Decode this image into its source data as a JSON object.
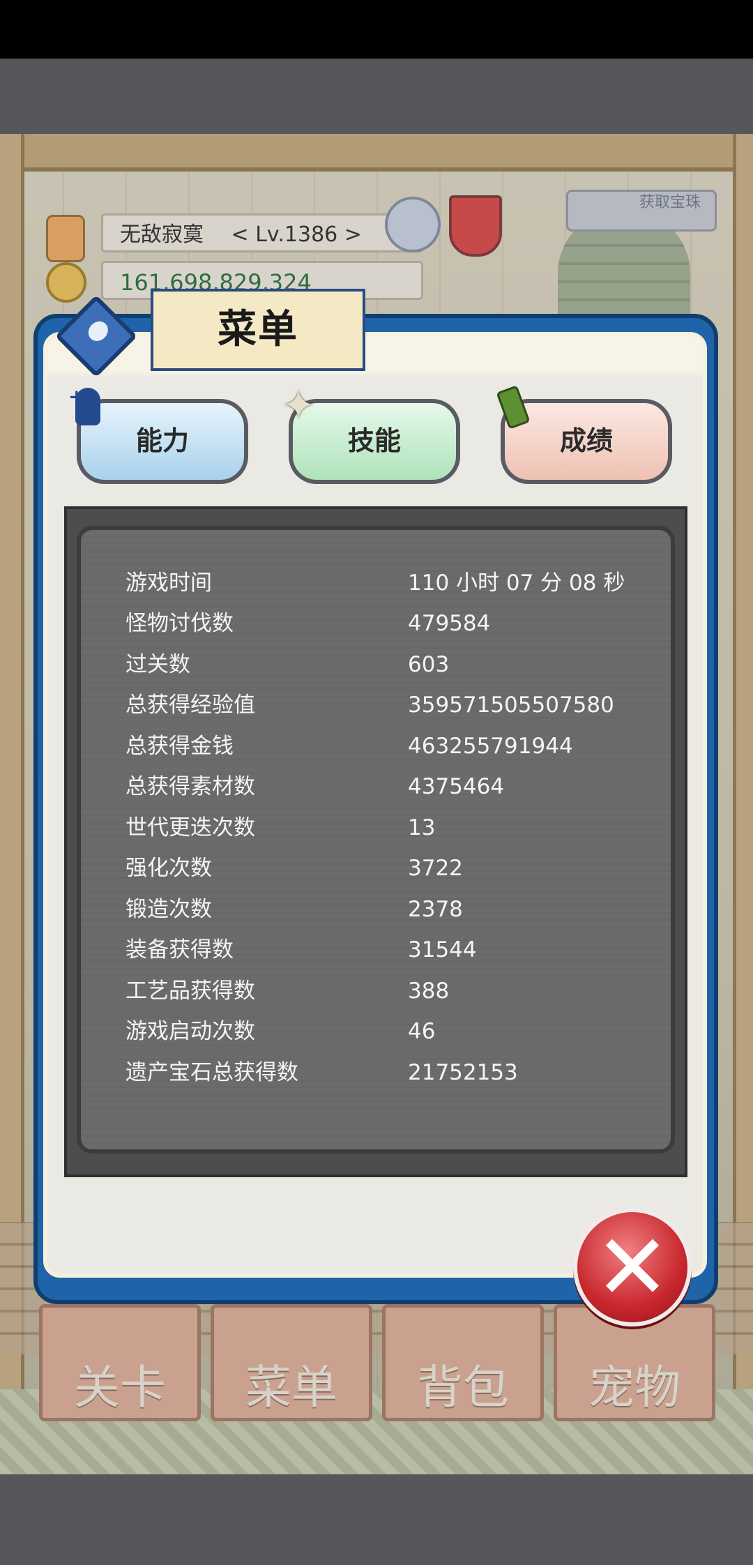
{
  "hud": {
    "player_name": "无敌寂寞",
    "level": "< Lv.1386 >",
    "gold": "161,698,829,324",
    "treasure_button": "获取宝珠"
  },
  "modal": {
    "title": "菜单",
    "tabs": [
      "能力",
      "技能",
      "成绩"
    ]
  },
  "stats": [
    {
      "label": "游戏时间",
      "value": "110 小时 07 分 08 秒"
    },
    {
      "label": "怪物讨伐数",
      "value": "479584"
    },
    {
      "label": "过关数",
      "value": "603"
    },
    {
      "label": "总获得经验值",
      "value": "359571505507580"
    },
    {
      "label": "总获得金钱",
      "value": "463255791944"
    },
    {
      "label": "总获得素材数",
      "value": "4375464"
    },
    {
      "label": "世代更迭次数",
      "value": "13"
    },
    {
      "label": "强化次数",
      "value": "3722"
    },
    {
      "label": "锻造次数",
      "value": "2378"
    },
    {
      "label": "装备获得数",
      "value": "31544"
    },
    {
      "label": "工艺品获得数",
      "value": "388"
    },
    {
      "label": "游戏启动次数",
      "value": "46"
    },
    {
      "label": "遗产宝石总获得数",
      "value": "21752153"
    }
  ],
  "nav": [
    "关卡",
    "菜单",
    "背包",
    "宠物"
  ],
  "icons": {
    "close": "close-icon",
    "menu_book": "book-icon",
    "ability": "person-plus-icon",
    "skill": "star-icon",
    "record": "scroll-icon"
  },
  "colors": {
    "modal_border": "#1f63a8",
    "stats_panel": "#6b6b6b",
    "close_button": "#c8282e"
  }
}
